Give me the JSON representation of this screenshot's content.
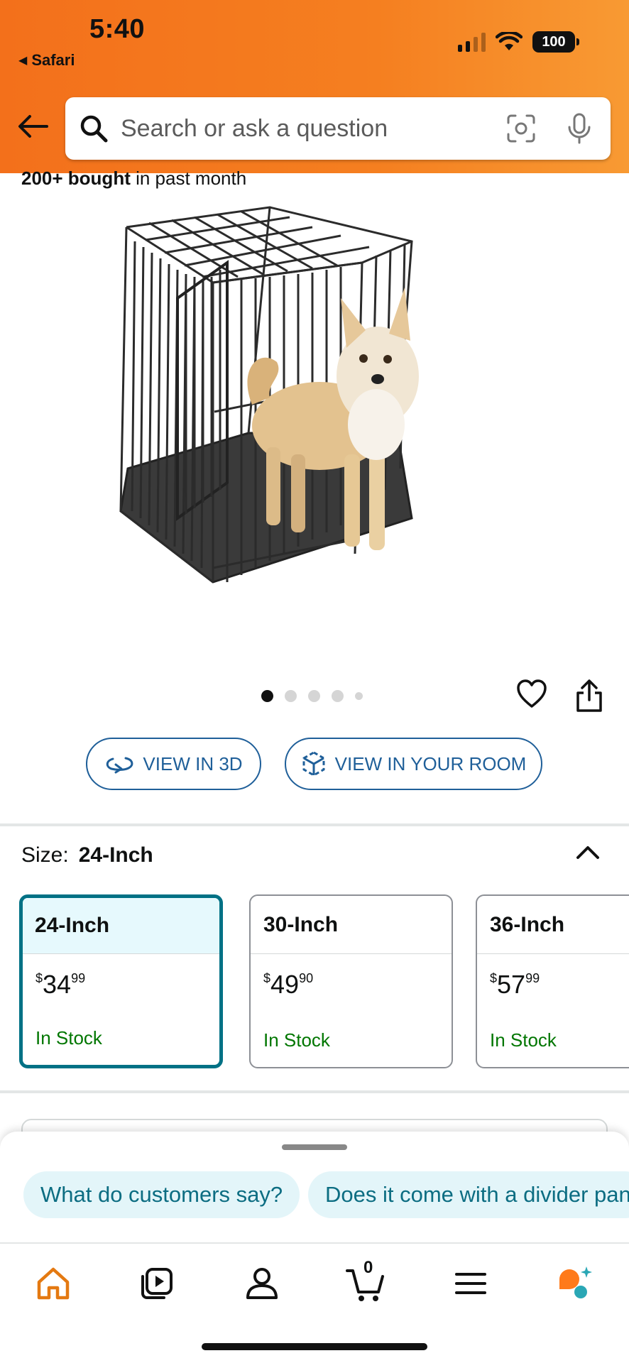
{
  "status_bar": {
    "time": "5:40",
    "back_app": "Safari",
    "battery": "100"
  },
  "search": {
    "placeholder": "Search or ask a question"
  },
  "product": {
    "bought_bold": "200+ bought",
    "bought_rest": " in past month",
    "image_count": 5,
    "active_image": 1
  },
  "buttons": {
    "view_3d": "VIEW IN 3D",
    "view_room": "VIEW IN YOUR ROOM"
  },
  "size": {
    "label": "Size:",
    "selected": "24-Inch",
    "options": [
      {
        "name": "24-Inch",
        "currency": "$",
        "dollars": "34",
        "cents": "99",
        "stock": "In Stock"
      },
      {
        "name": "30-Inch",
        "currency": "$",
        "dollars": "49",
        "cents": "90",
        "stock": "In Stock"
      },
      {
        "name": "36-Inch",
        "currency": "$",
        "dollars": "57",
        "cents": "99",
        "stock": "In Stock"
      }
    ]
  },
  "chips": {
    "q1": "What do customers say?",
    "q2": "Does it come with a divider pan"
  },
  "tabbar": {
    "cart_count": "0"
  },
  "colors": {
    "header_orange": "#f57f20",
    "link_blue": "#1f5f99",
    "selected_teal": "#007185",
    "in_stock_green": "#007600",
    "chip_bg": "#e3f5f9",
    "home_active": "#e47911"
  },
  "icons": [
    "back-arrow-icon",
    "search-icon",
    "camera-icon",
    "mic-icon",
    "heart-icon",
    "share-icon",
    "rotate-3d-icon",
    "ar-cube-icon",
    "chevron-up-icon",
    "home-icon",
    "video-icon",
    "account-icon",
    "cart-icon",
    "menu-icon",
    "rufus-icon"
  ]
}
